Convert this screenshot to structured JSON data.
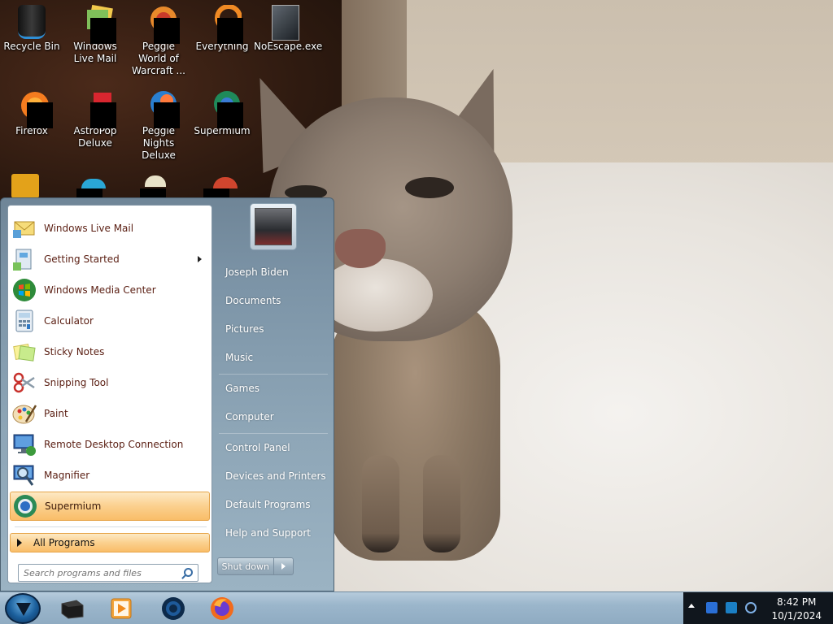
{
  "desktop": {
    "icons": [
      {
        "label": "Recycle Bin",
        "icon": "recycle-bin-icon"
      },
      {
        "label": "Windows Live Mail",
        "icon": "windows-live-mail-icon"
      },
      {
        "label": "Peggle World of Warcraft ...",
        "icon": "peggle-wow-icon"
      },
      {
        "label": "Everything",
        "icon": "everything-icon"
      },
      {
        "label": "NoEscape.exe",
        "icon": "noescape-exe-icon"
      },
      {
        "label": "Firefox",
        "icon": "firefox-icon"
      },
      {
        "label": "AstroPop Deluxe",
        "icon": "astropop-icon"
      },
      {
        "label": "Peggle Nights Deluxe",
        "icon": "peggle-nights-icon"
      },
      {
        "label": "Supermium",
        "icon": "supermium-icon"
      }
    ]
  },
  "start_menu": {
    "pinned": [
      {
        "label": "Windows Live Mail",
        "icon": "mail-icon"
      },
      {
        "label": "Getting Started",
        "icon": "getting-started-icon",
        "has_submenu": true
      },
      {
        "label": "Windows Media Center",
        "icon": "media-center-icon"
      },
      {
        "label": "Calculator",
        "icon": "calculator-icon"
      },
      {
        "label": "Sticky Notes",
        "icon": "sticky-notes-icon"
      },
      {
        "label": "Snipping Tool",
        "icon": "scissors-icon"
      },
      {
        "label": "Paint",
        "icon": "paint-icon"
      },
      {
        "label": "Remote Desktop Connection",
        "icon": "remote-desktop-icon"
      },
      {
        "label": "Magnifier",
        "icon": "magnifier-icon"
      },
      {
        "label": "Supermium",
        "icon": "supermium-icon",
        "highlighted": true
      }
    ],
    "all_programs_label": "All Programs",
    "search_placeholder": "Search programs and files",
    "right_items": [
      {
        "label": "Joseph Biden"
      },
      {
        "label": "Documents"
      },
      {
        "label": "Pictures"
      },
      {
        "label": "Music"
      },
      {
        "label": "Games"
      },
      {
        "label": "Computer"
      },
      {
        "label": "Control Panel"
      },
      {
        "label": "Devices and Printers"
      },
      {
        "label": "Default Programs"
      },
      {
        "label": "Help and Support"
      }
    ],
    "shutdown_label": "Shut down"
  },
  "taskbar": {
    "apps": [
      "black-box-app-icon",
      "media-player-icon",
      "supermium-icon",
      "firefox-icon"
    ],
    "clock_time": "8:42 PM",
    "clock_date": "10/1/2024"
  },
  "colors": {
    "highlight": "#fbd08e",
    "menu_text": "#5a1e12",
    "tray_bg": "#10161d"
  }
}
